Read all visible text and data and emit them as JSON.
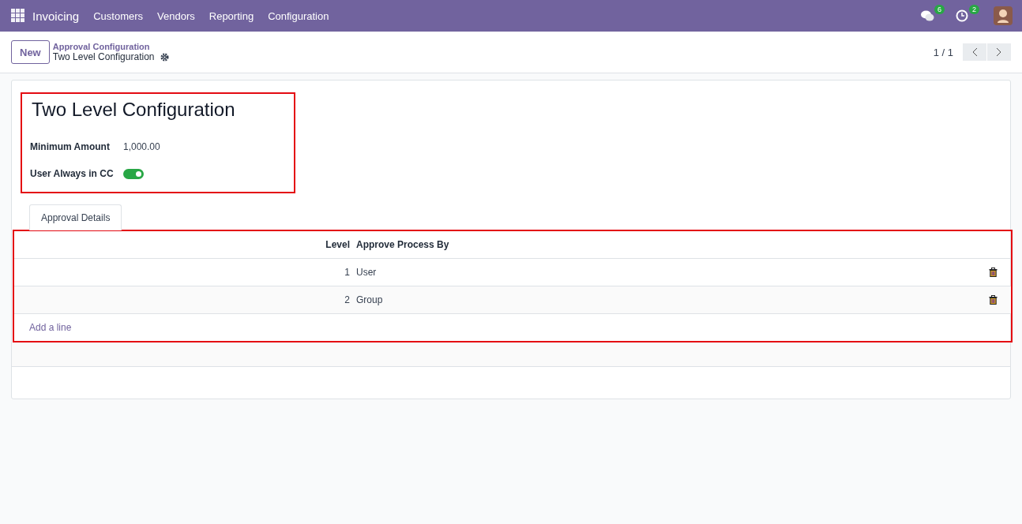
{
  "navbar": {
    "app_name": "Invoicing",
    "menu": [
      "Customers",
      "Vendors",
      "Reporting",
      "Configuration"
    ],
    "messages_count": "6",
    "activities_count": "2"
  },
  "control_panel": {
    "new_button": "New",
    "breadcrumb_parent": "Approval Configuration",
    "breadcrumb_current": "Two Level Configuration",
    "pager": "1 / 1"
  },
  "form": {
    "title": "Two Level Configuration",
    "fields": [
      {
        "kind": "text",
        "label": "Minimum Amount",
        "value": "1,000.00"
      },
      {
        "kind": "toggle",
        "label": "User Always in CC",
        "on": true
      }
    ],
    "tabs": [
      {
        "label": "Approval Details",
        "selected": true
      }
    ],
    "table": {
      "columns": [
        "Level",
        "Approve Process By"
      ],
      "rows": [
        {
          "level": "1",
          "approve_process_by": "User"
        },
        {
          "level": "2",
          "approve_process_by": "Group"
        }
      ],
      "add_line": "Add a line"
    }
  }
}
